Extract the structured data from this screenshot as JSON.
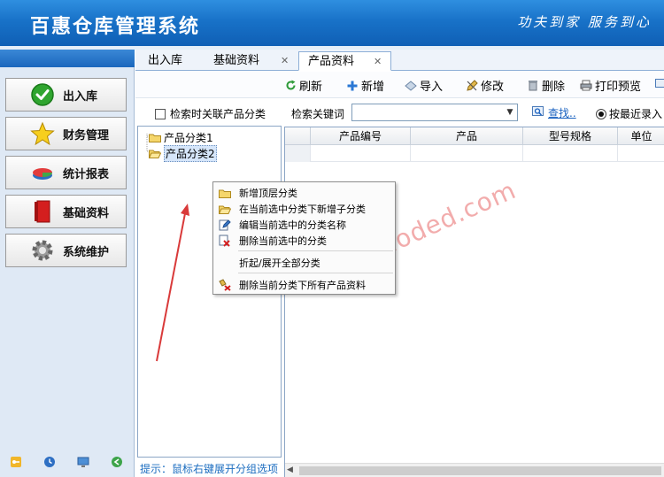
{
  "app": {
    "title": "百惠仓库管理系统",
    "slogan": "功夫到家 服务到心"
  },
  "sidebar": {
    "items": [
      {
        "label": "出入库",
        "icon": "check-circle-icon"
      },
      {
        "label": "财务管理",
        "icon": "star-icon"
      },
      {
        "label": "统计报表",
        "icon": "pie-chart-icon"
      },
      {
        "label": "基础资料",
        "icon": "book-icon"
      },
      {
        "label": "系统维护",
        "icon": "gear-icon"
      }
    ],
    "bottom_icons": [
      "key-icon",
      "clock-icon",
      "monitor-icon",
      "exit-icon"
    ]
  },
  "tabs": [
    {
      "label": "出入库",
      "closable": false
    },
    {
      "label": "基础资料",
      "closable": true
    },
    {
      "label": "产品资料",
      "closable": true,
      "active": true
    }
  ],
  "toolbar": {
    "refresh": "刷新",
    "add": "新增",
    "import": "导入",
    "edit": "修改",
    "delete": "删除",
    "print_preview": "打印预览"
  },
  "tree": {
    "checkbox_label": "检索时关联产品分类",
    "nodes": [
      {
        "label": "产品分类1",
        "selected": false
      },
      {
        "label": "产品分类2",
        "selected": true
      }
    ],
    "hint": "提示：鼠标右键展开分组选项"
  },
  "search": {
    "label": "检索关键词",
    "value": "",
    "find_label": "查找..",
    "radio_label": "按最近录入日"
  },
  "grid": {
    "columns": [
      "产品编号",
      "产品",
      "型号规格",
      "单位"
    ]
  },
  "context_menu": {
    "items": [
      {
        "label": "新增顶层分类",
        "icon": "folder-icon"
      },
      {
        "label": "在当前选中分类下新增子分类",
        "icon": "folder-open-icon"
      },
      {
        "label": "编辑当前选中的分类名称",
        "icon": "edit-icon"
      },
      {
        "label": "删除当前选中的分类",
        "icon": "delete-icon"
      },
      {
        "label": "折起/展开全部分类",
        "icon": ""
      },
      {
        "label": "删除当前分类下所有产品资料",
        "icon": "delete-all-icon"
      }
    ]
  },
  "watermark": "www.haoded.com",
  "colors": {
    "header_blue": "#1872c8",
    "accent_link": "#1a62c0",
    "annotation_red": "#d93a3a"
  }
}
